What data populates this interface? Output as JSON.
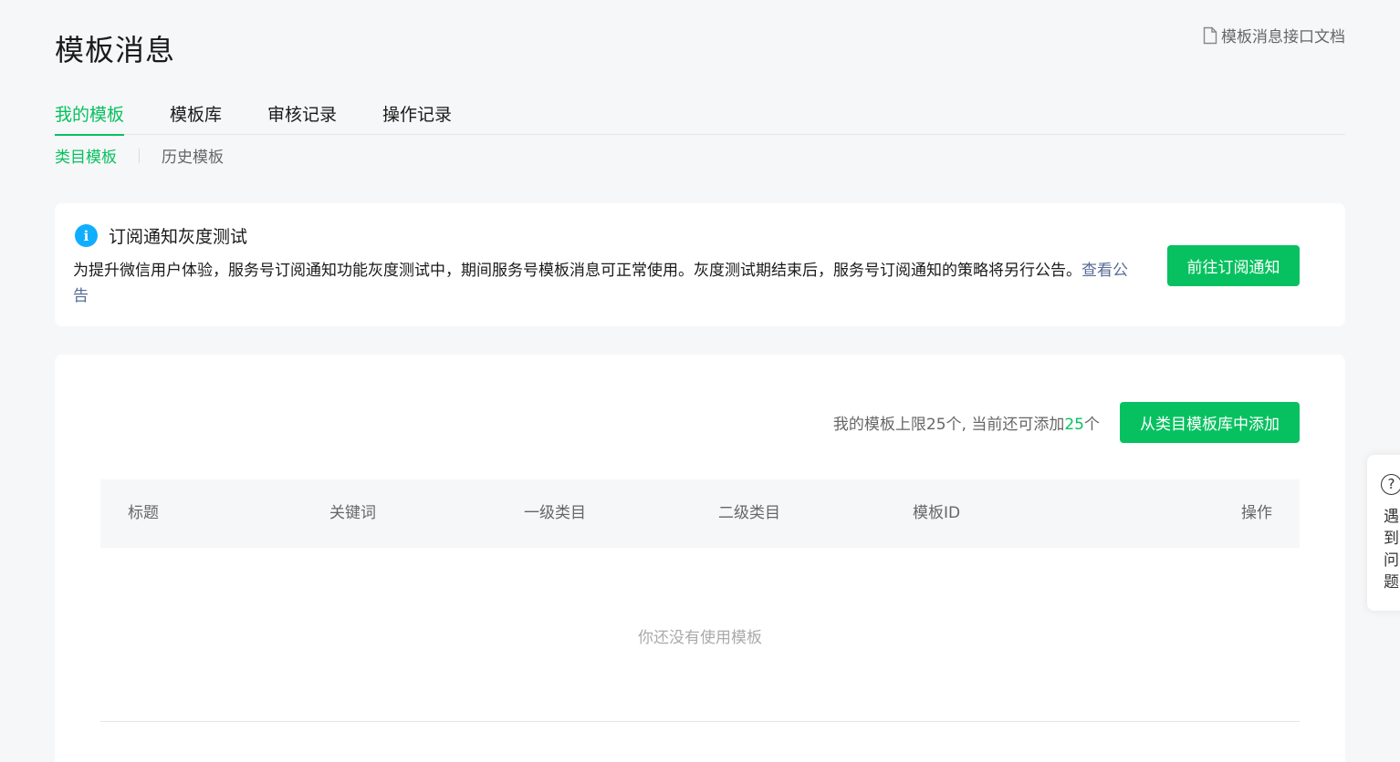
{
  "header": {
    "title": "模板消息",
    "doc_link": "模板消息接口文档"
  },
  "tabs": [
    {
      "label": "我的模板",
      "active": true
    },
    {
      "label": "模板库",
      "active": false
    },
    {
      "label": "审核记录",
      "active": false
    },
    {
      "label": "操作记录",
      "active": false
    }
  ],
  "subtabs": [
    {
      "label": "类目模板",
      "active": true
    },
    {
      "label": "历史模板",
      "active": false
    }
  ],
  "notice": {
    "title": "订阅通知灰度测试",
    "body": "为提升微信用户体验，服务号订阅通知功能灰度测试中，期间服务号模板消息可正常使用。灰度测试期结束后，服务号订阅通知的策略将另行公告。",
    "link": "查看公告",
    "button": "前往订阅通知"
  },
  "panel": {
    "limit_prefix": "我的模板上限25个, 当前还可添加",
    "limit_count": "25",
    "limit_suffix": "个",
    "add_button": "从类目模板库中添加",
    "columns": [
      "标题",
      "关键词",
      "一级类目",
      "二级类目",
      "模板ID",
      "操作"
    ],
    "empty_text": "你还没有使用模板"
  },
  "help": {
    "label": "遇到问题"
  },
  "colors": {
    "accent": "#07c160",
    "link": "#576b95",
    "info": "#10aeff"
  }
}
